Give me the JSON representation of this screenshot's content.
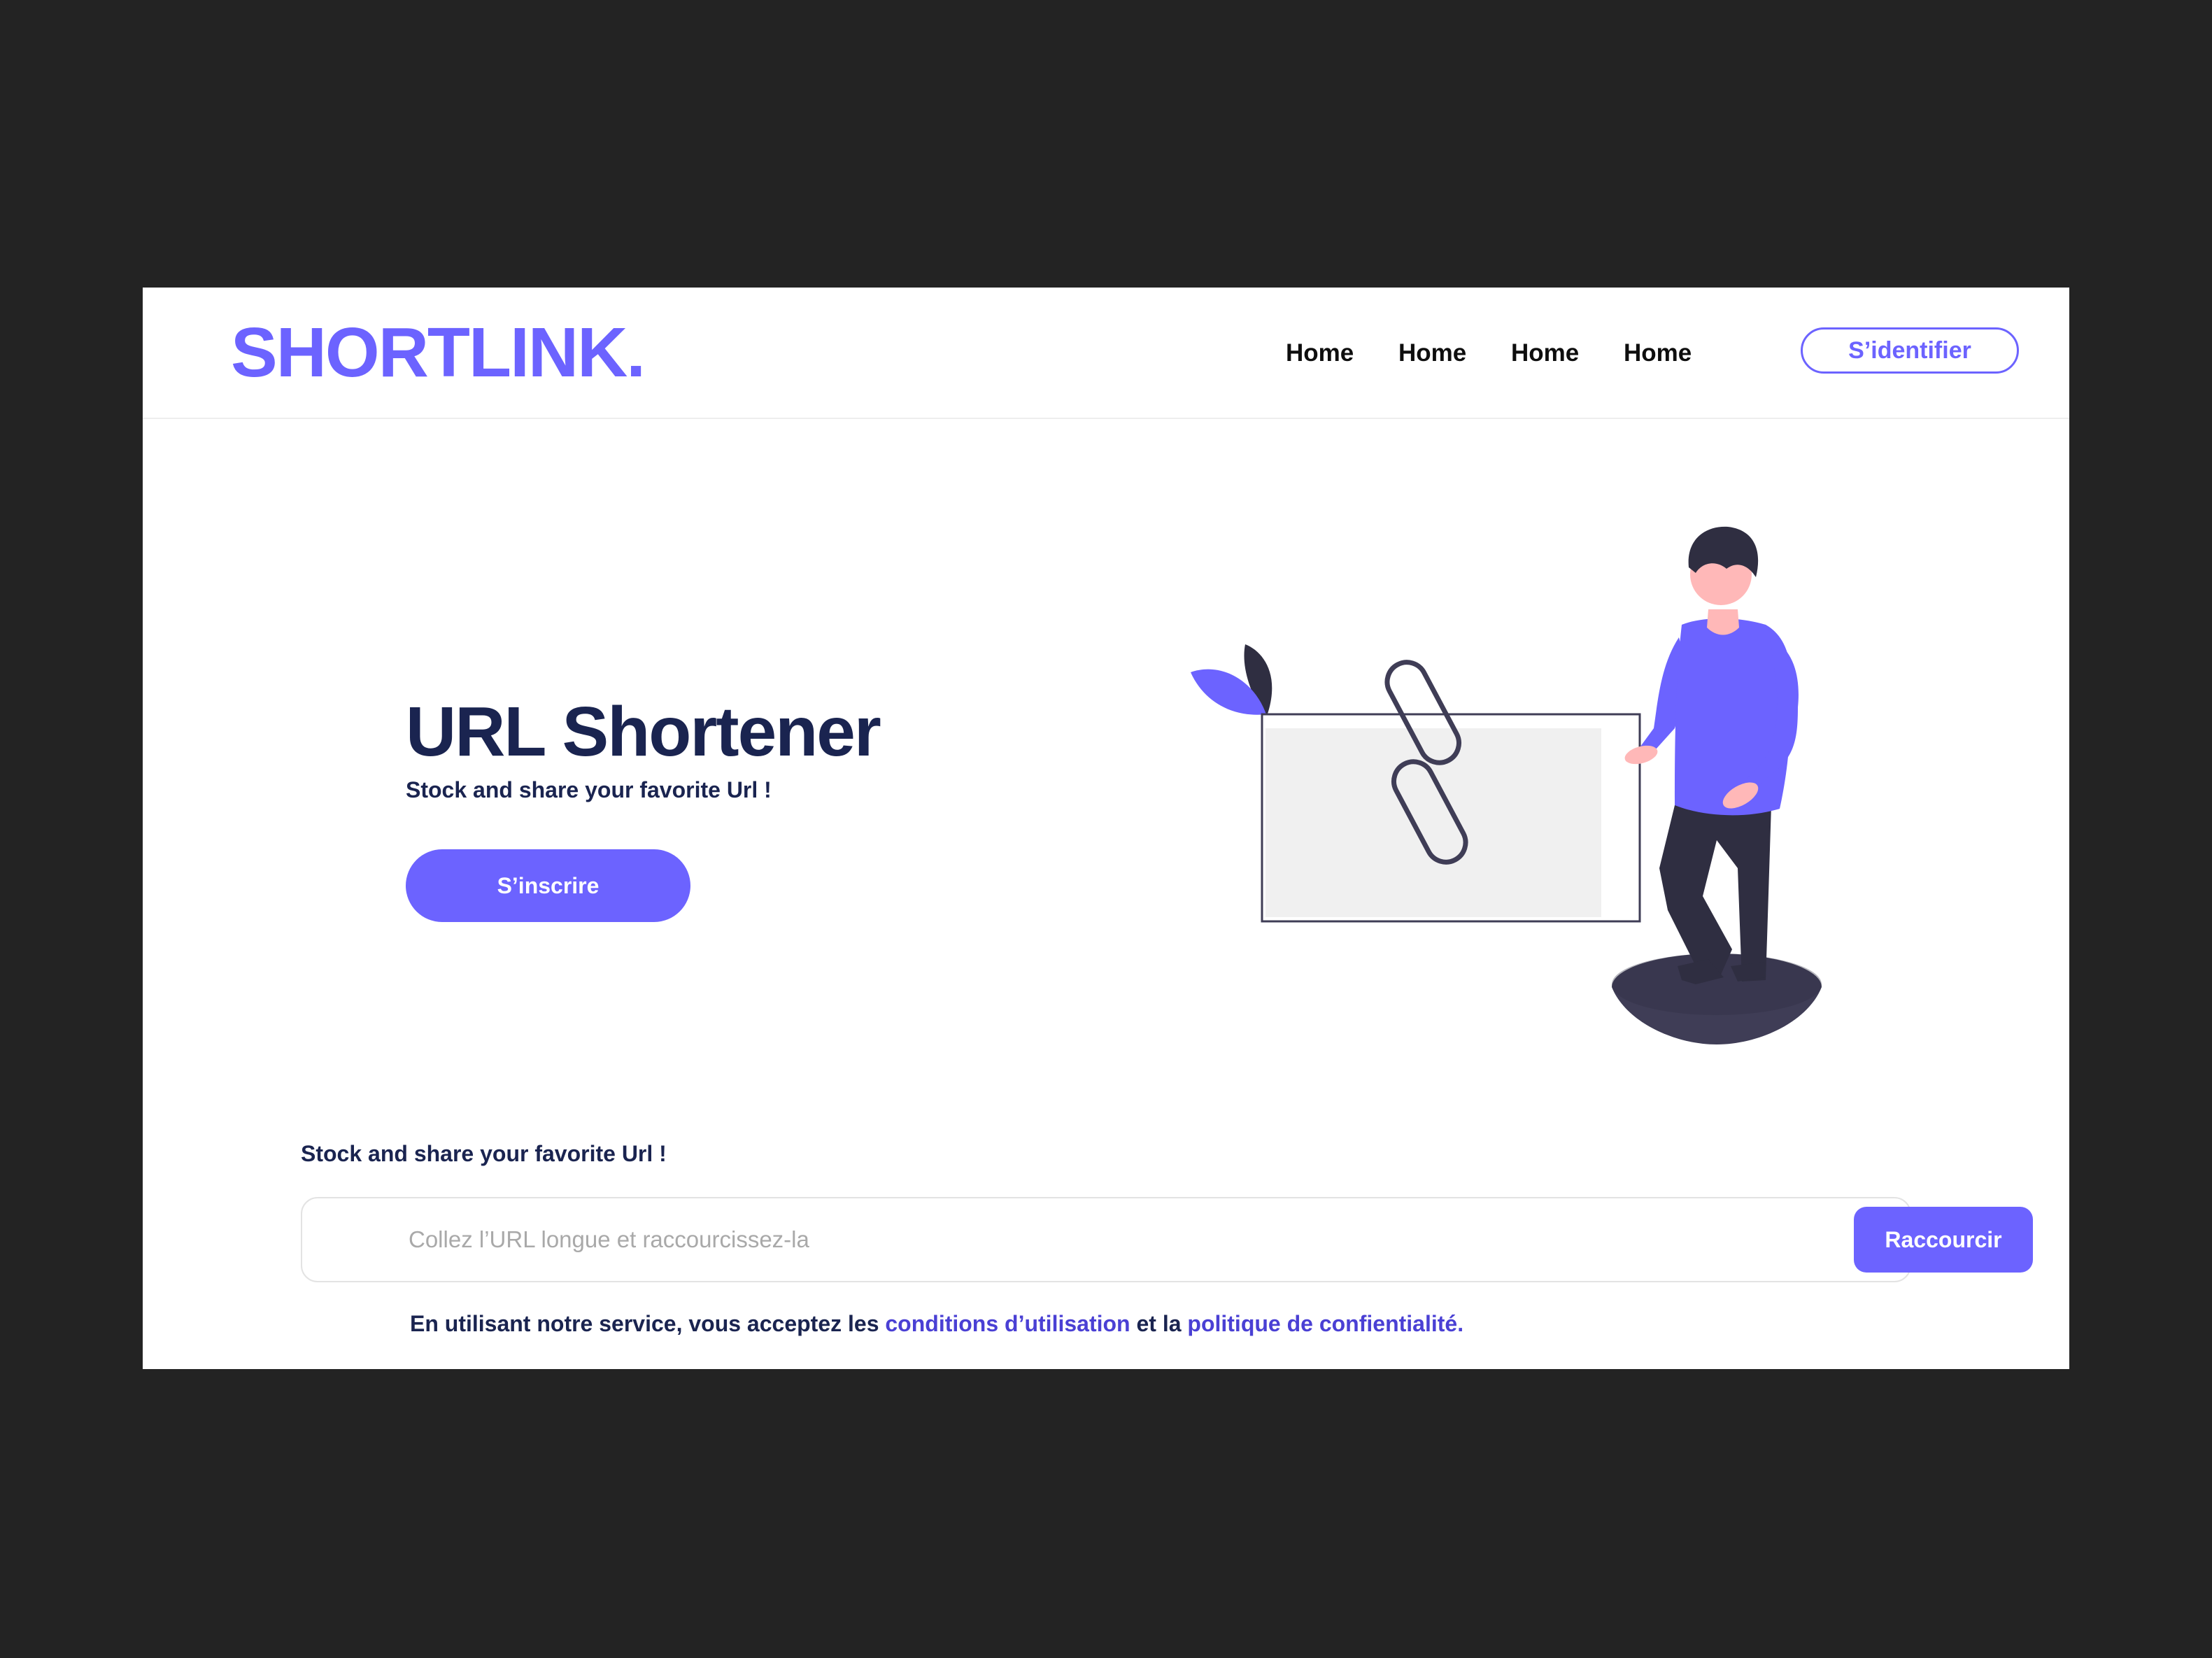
{
  "brand": {
    "logo": "SHORTLINK.",
    "accent_color": "#6c63ff",
    "dark_text_color": "#1a2450"
  },
  "nav": {
    "links": [
      "Home",
      "Home",
      "Home",
      "Home"
    ],
    "login_label": "S’identifier"
  },
  "hero": {
    "title": "URL Shortener",
    "subtitle": "Stock and share your favorite Url !",
    "signup_label": "S’inscrire",
    "illustration_icon": "link-chain-icon"
  },
  "shortener": {
    "label": "Stock and share your favorite Url !",
    "input_placeholder": "Collez l’URL longue et raccourcissez-la",
    "input_value": "",
    "button_label": "Raccourcir"
  },
  "terms": {
    "prefix": "En utilisant notre service, vous acceptez les ",
    "conditions_link": "conditions d’utilisation",
    "middle": " et la ",
    "privacy_link": "politique de confientialité."
  }
}
